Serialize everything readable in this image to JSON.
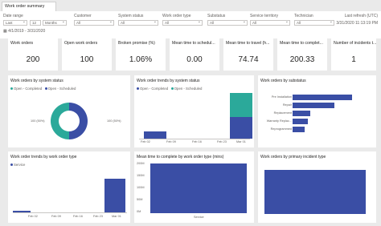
{
  "tab": {
    "label": "Work order summary"
  },
  "filters": {
    "date_range": {
      "label": "Date range",
      "mode": "Last",
      "count": "12",
      "unit": "Months",
      "range": "4/1/2019 - 3/31/2020"
    },
    "customer": {
      "label": "Customer",
      "value": "All"
    },
    "system_status": {
      "label": "System status",
      "value": "All"
    },
    "work_order_type": {
      "label": "Work order type",
      "value": "All"
    },
    "substatus": {
      "label": "Substatus",
      "value": "All"
    },
    "service_territory": {
      "label": "Service territory",
      "value": "All"
    },
    "technician": {
      "label": "Technician",
      "value": "All"
    },
    "last_refresh": {
      "label": "Last refresh (UTC)",
      "value": "3/31/2020 11:13:19 PM"
    }
  },
  "kpis": [
    {
      "title": "Work orders",
      "value": "200"
    },
    {
      "title": "Open work orders",
      "value": "100"
    },
    {
      "title": "Broken promise (%)",
      "value": "1.06%"
    },
    {
      "title": "Mean time to schedul...",
      "value": "0.00"
    },
    {
      "title": "Mean time to travel (h...",
      "value": "74.74"
    },
    {
      "title": "Mean time to complet...",
      "value": "200.33"
    },
    {
      "title": "Number of incidents t...",
      "value": "1"
    }
  ],
  "panels": {
    "by_system_status": {
      "title": "Work orders by system status",
      "legend": [
        "Open - Completed",
        "Open - Scheduled"
      ],
      "label_left": "100 (50%)",
      "label_right": "100 (50%)"
    },
    "trends_by_status": {
      "title": "Work order trends by system status",
      "legend": [
        "Open - Completed",
        "Open - Scheduled"
      ],
      "ticks": [
        "Feb 02",
        "Feb 09",
        "Feb 16",
        "Feb 23",
        "Mar 01"
      ]
    },
    "by_substatus": {
      "title": "Work orders by substatus",
      "ticks": [
        "Pre Installation",
        "Repair",
        "Replacement",
        "Warranty Replac...",
        "Reprogrammed"
      ]
    },
    "trends_by_type": {
      "title": "Work order trends by work order type",
      "legend": [
        "Service"
      ],
      "ticks": [
        "Feb 02",
        "Feb 09",
        "Feb 16",
        "Feb 23",
        "Mar 01"
      ]
    },
    "mean_time_complete": {
      "title": "Mean time to complete by work order type (mins)",
      "y_ticks": [
        "200M",
        "150M",
        "100M",
        "50M",
        "0M"
      ],
      "x_ticks": [
        "Service"
      ]
    },
    "by_incident_type": {
      "title": "Work orders by primary incident type"
    }
  },
  "chart_data": [
    {
      "type": "pie",
      "categories": [
        "Open - Completed",
        "Open - Scheduled"
      ],
      "values": [
        100,
        100
      ],
      "colors": [
        "#2ba99a",
        "#3a4ea5"
      ]
    },
    {
      "type": "bar",
      "categories": [
        "Feb 02",
        "Feb 09",
        "Feb 16",
        "Feb 23",
        "Mar 01"
      ],
      "series": [
        {
          "name": "Open - Completed",
          "values": [
            0,
            0,
            0,
            0,
            100
          ]
        },
        {
          "name": "Open - Scheduled",
          "values": [
            30,
            0,
            0,
            0,
            90
          ]
        }
      ]
    },
    {
      "type": "bar",
      "categories": [
        "Pre Installation",
        "Repair",
        "Replacement",
        "Warranty Replac...",
        "Reprogrammed"
      ],
      "values": [
        100,
        70,
        30,
        25,
        20
      ]
    },
    {
      "type": "bar",
      "categories": [
        "Feb 02",
        "Feb 09",
        "Feb 16",
        "Feb 23",
        "Mar 01"
      ],
      "series": [
        {
          "name": "Service",
          "values": [
            5,
            0,
            0,
            0,
            100
          ]
        }
      ]
    },
    {
      "type": "bar",
      "categories": [
        "Service"
      ],
      "values": [
        200
      ],
      "ylim": [
        0,
        200
      ]
    }
  ],
  "colors": {
    "primary": "#3a4ea5",
    "secondary": "#2ba99a"
  }
}
